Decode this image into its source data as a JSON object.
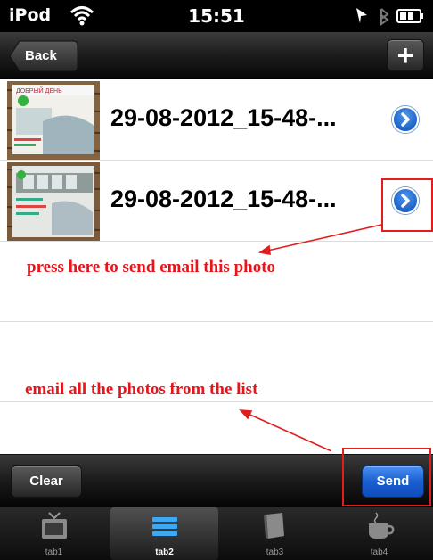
{
  "status_bar": {
    "carrier": "iPod",
    "time": "15:51"
  },
  "navbar": {
    "back_label": "Back",
    "add_label": "+"
  },
  "list": {
    "items": [
      {
        "title": "29-08-2012_15-48-...",
        "thumb_caption": "ДОБРЫЙ ДЕНЬ"
      },
      {
        "title": "29-08-2012_15-48-..."
      }
    ]
  },
  "annotations": {
    "send_one": "press here to send email this photo",
    "send_all": "email all the photos from the list"
  },
  "toolbar": {
    "clear_label": "Clear",
    "send_label": "Send"
  },
  "tabs": [
    {
      "label": "tab1",
      "icon": "tv-icon"
    },
    {
      "label": "tab2",
      "icon": "list-icon",
      "selected": true
    },
    {
      "label": "tab3",
      "icon": "book-icon"
    },
    {
      "label": "tab4",
      "icon": "coffee-icon"
    }
  ],
  "colors": {
    "annotation": "#e8141a",
    "send_button": "#1b5fd0",
    "disclosure": "#2a72d6"
  }
}
